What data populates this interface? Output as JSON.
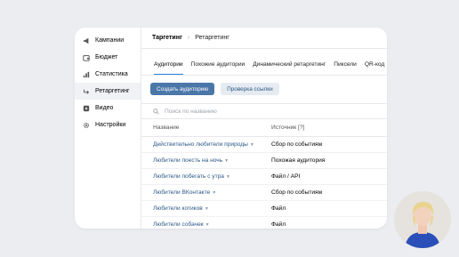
{
  "sidebar": {
    "items": [
      {
        "label": "Кампании",
        "icon": "megaphone-icon"
      },
      {
        "label": "Бюджет",
        "icon": "wallet-icon"
      },
      {
        "label": "Статистика",
        "icon": "stats-icon"
      },
      {
        "label": "Ретаргетинг",
        "icon": "retarget-icon",
        "active": true
      },
      {
        "label": "Видео",
        "icon": "video-icon"
      },
      {
        "label": "Настройки",
        "icon": "gear-icon"
      }
    ]
  },
  "breadcrumb": {
    "root": "Таргетинг",
    "separator": "›",
    "current": "Ретаргетинг"
  },
  "tabs": [
    "Аудитории",
    "Похожие аудитории",
    "Динамический ретаргетинг",
    "Пиксели",
    "QR-код"
  ],
  "buttons": {
    "create": "Создать аудиторию",
    "check_link": "Проверка ссылки"
  },
  "search": {
    "placeholder": "Поиск по названию"
  },
  "table": {
    "headers": [
      "Название",
      "Источник [?]"
    ],
    "rows": [
      {
        "name": "Действительно любители природы",
        "source": "Сбор по событиям"
      },
      {
        "name": "Любители поесть на ночь",
        "source": "Похожая аудитория"
      },
      {
        "name": "Любители побегать с утра",
        "source": "Файл / API"
      },
      {
        "name": "Любители ВКонтакте",
        "source": "Сбор по событиям"
      },
      {
        "name": "Любители котиков",
        "source": "Файл"
      },
      {
        "name": "Любители собачек",
        "source": "Файл"
      }
    ]
  },
  "colors": {
    "accent": "#4a76a8",
    "link": "#2a5885",
    "tab_underline": "#2d81e0"
  }
}
